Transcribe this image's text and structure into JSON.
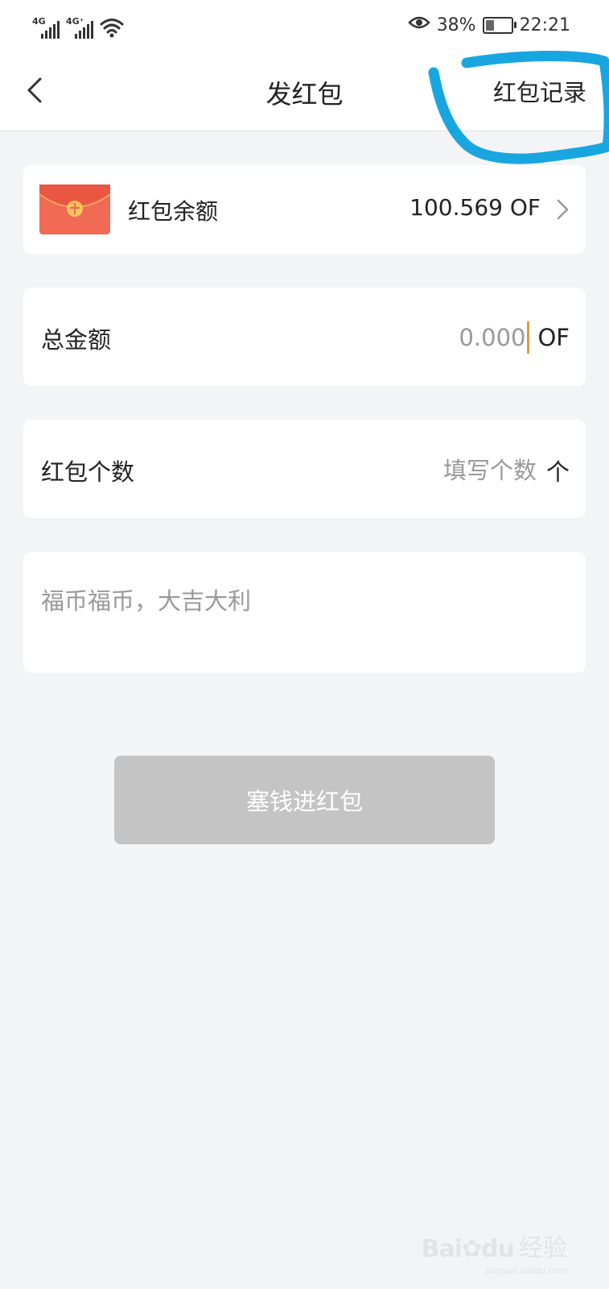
{
  "status_bar": {
    "signal1_type": "4G",
    "signal2_type": "4G⁺",
    "battery_percent": "38%",
    "time": "22:21",
    "battery_level": 0.38
  },
  "nav": {
    "title": "发红包",
    "action": "红包记录",
    "back_icon": "chevron-left-icon"
  },
  "annotation": {
    "color": "#18a6e0"
  },
  "balance": {
    "label": "红包余额",
    "value": "100.569 OF",
    "icon": "red-envelope-icon"
  },
  "total": {
    "label": "总金额",
    "placeholder": "0.000",
    "unit": "OF"
  },
  "count": {
    "label": "红包个数",
    "placeholder": "填写个数",
    "unit": "个"
  },
  "message": {
    "placeholder": "福币福币，大吉大利"
  },
  "submit": {
    "label": "塞钱进红包"
  },
  "watermark": {
    "logo": "Bai",
    "logo2": "du",
    "text": "经验",
    "sub": "jingyan.baidu.com"
  },
  "colors": {
    "background": "#f3f4f6",
    "button_disabled": "#c4c4c4",
    "envelope": "#f06a55",
    "cursor": "#e09a3c"
  }
}
